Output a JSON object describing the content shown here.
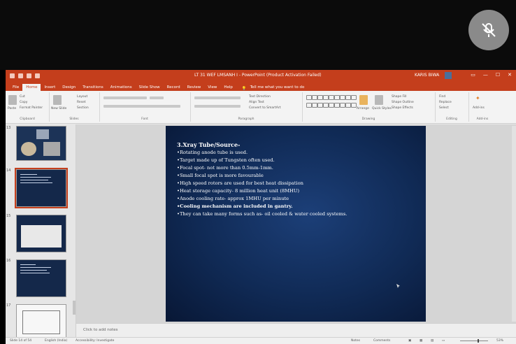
{
  "window": {
    "title": "LT 31 WEF LMSANH I - PowerPoint (Product Activation Failed)",
    "user": "KARIS BIWA"
  },
  "tabs": [
    "File",
    "Home",
    "Insert",
    "Design",
    "Transitions",
    "Animations",
    "Slide Show",
    "Record",
    "Review",
    "View",
    "Help"
  ],
  "active_tab": "Home",
  "tell_me": "Tell me what you want to do",
  "ribbon": {
    "paste": "Paste",
    "cut": "Cut",
    "copy": "Copy",
    "format_painter": "Format Painter",
    "new_slide": "New Slide",
    "layout": "Layout",
    "reset": "Reset",
    "section": "Section",
    "text_direction": "Text Direction",
    "align_text": "Align Text",
    "convert_smartart": "Convert to SmartArt",
    "arrange": "Arrange",
    "quick_styles": "Quick Styles",
    "shape_fill": "Shape Fill",
    "shape_outline": "Shape Outline",
    "shape_effects": "Shape Effects",
    "find": "Find",
    "replace": "Replace",
    "select": "Select",
    "addins": "Add-ins",
    "groups": [
      "Clipboard",
      "Slides",
      "Font",
      "Paragraph",
      "Drawing",
      "Editing",
      "Add-ins"
    ]
  },
  "thumbnails": [
    {
      "num": "13"
    },
    {
      "num": "14"
    },
    {
      "num": "15"
    },
    {
      "num": "16"
    },
    {
      "num": "17"
    }
  ],
  "slide": {
    "heading": "3.Xray Tube/Source-",
    "bullets": [
      "•Rotating anode tube is used.",
      "•Target made up of Tungsten often used.",
      "•Focal spot- not more than 0.5mm-1mm.",
      "•Small focal spot is more favourable",
      "•High speed rotors are used for best heat dissipation",
      "•Heat storage capacity- 8 million heat unit (8MHU)",
      "•Anode cooling rate- approx 1MHU per minute",
      "•Cooling mechanism are included in gantry.",
      "•They can take many forms such as- oil cooled & water cooled systems."
    ]
  },
  "notes_placeholder": "Click to add notes",
  "status": {
    "slide_info": "Slide 14 of 54",
    "language": "English (India)",
    "accessibility": "Accessibility: Investigate",
    "notes": "Notes",
    "comments": "Comments",
    "zoom": "53%"
  },
  "colors": {
    "accent": "#c43e1c",
    "slide_bg": "#102a55"
  }
}
